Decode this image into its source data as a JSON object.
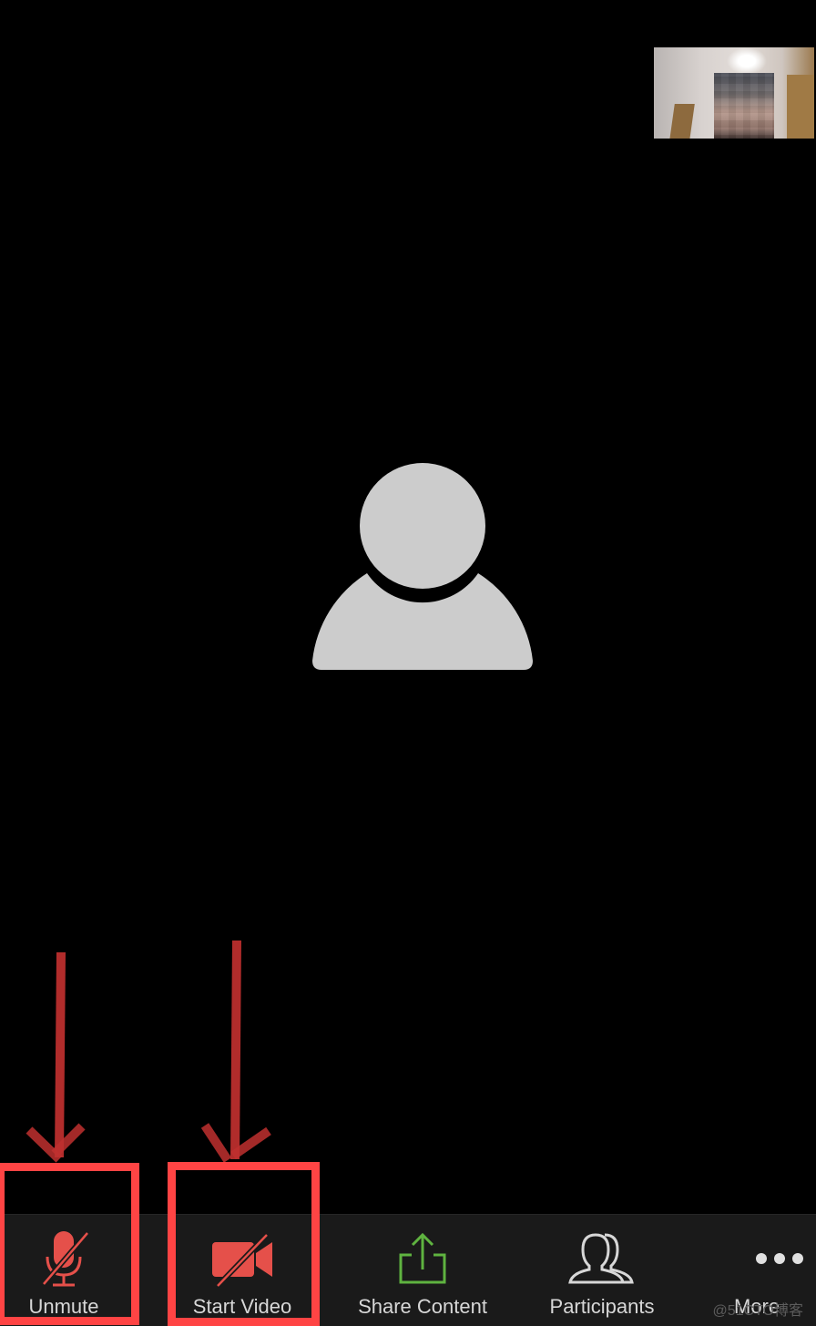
{
  "meeting": {
    "participant_avatar": "person-placeholder-icon",
    "self_view": "self-video-thumbnail"
  },
  "toolbar": {
    "buttons": [
      {
        "label": "Unmute",
        "icon": "microphone-muted-icon",
        "color": "#e5504a",
        "highlighted": true
      },
      {
        "label": "Start Video",
        "icon": "video-camera-off-icon",
        "color": "#e5504a",
        "highlighted": true
      },
      {
        "label": "Share Content",
        "icon": "share-upload-icon",
        "color": "#5fb340",
        "highlighted": false
      },
      {
        "label": "Participants",
        "icon": "participants-icon",
        "color": "#d7d7d7",
        "highlighted": false
      },
      {
        "label": "More",
        "icon": "more-dots-icon",
        "color": "#d7d7d7",
        "highlighted": false
      }
    ]
  },
  "annotations": {
    "arrow_color": "#c0302f",
    "highlight_color": "#ff4444"
  },
  "watermark": "@51CTO博客"
}
